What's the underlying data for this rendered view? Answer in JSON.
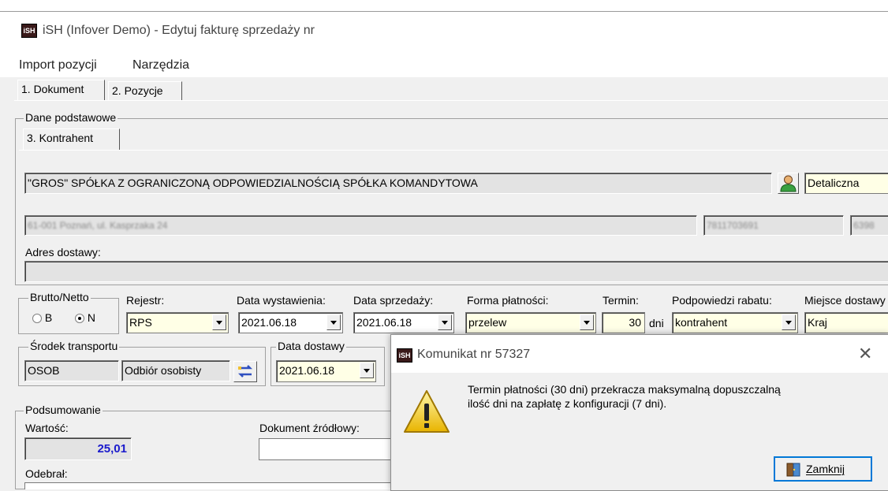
{
  "window": {
    "title": "iSH (Infover Demo) - Edytuj fakturę sprzedaży nr",
    "icon": "ish-app-icon"
  },
  "menu": [
    "Import pozycji",
    "Narzędzia"
  ],
  "tabs": [
    "1. Dokument",
    "2. Pozycje"
  ],
  "dane_podstawowe": {
    "label": "Dane podstawowe",
    "subtab": "3. Kontrahent",
    "kontrahent_name": "\"GROS\" SPÓŁKA Z OGRANICZONĄ ODPOWIEDZIALNOŚCIĄ SPÓŁKA KOMANDYTOWA",
    "kontrahent_icon": "person-icon",
    "cennik": "Detaliczna",
    "adres": "61-001 Poznań, ul. Kasprzaka 24",
    "nip": "7811703691",
    "regon": "6398",
    "adres_dostawy_label": "Adres dostawy:",
    "adres_dostawy_value": ""
  },
  "params": {
    "brutto_netto_label": "Brutto/Netto",
    "radio_b": "B",
    "radio_n": "N",
    "rejestr_label": "Rejestr:",
    "rejestr_value": "RPS",
    "data_wyst_label": "Data wystawienia:",
    "data_wyst_value": "2021.06.18",
    "data_sprz_label": "Data sprzedaży:",
    "data_sprz_value": "2021.06.18",
    "forma_label": "Forma płatności:",
    "forma_value": "przelew",
    "termin_label": "Termin:",
    "termin_value": "30",
    "dni_label": "dni",
    "rabat_label": "Podpowiedzi rabatu:",
    "rabat_value": "kontrahent",
    "miejsce_label": "Miejsce dostawy",
    "miejsce_value": "Kraj"
  },
  "transport": {
    "label": "Środek transportu",
    "code": "OSOB",
    "name": "Odbiór osobisty",
    "button_icon": "transfer-icon"
  },
  "dostawa": {
    "label": "Data dostawy",
    "value": "2021.06.18"
  },
  "podsumowanie": {
    "label": "Podsumowanie",
    "wartosc_label": "Wartość:",
    "wartosc_value": "25,01",
    "dok_zrodlowy_label": "Dokument źródłowy:",
    "odebral_label": "Odebrał:"
  },
  "dialog": {
    "title": "Komunikat nr 57327",
    "message_line1": "Termin płatności (30 dni) przekracza maksymalną dopuszczalną",
    "message_line2": "ilość dni na zapłatę z konfiguracji (7 dni).",
    "icon": "warning-icon",
    "close_button": "Zamknij",
    "close_icon": "door-exit-icon",
    "x_icon": "close-icon"
  },
  "colors": {
    "accent": "#0078d7",
    "value_blue": "#1a1acc",
    "combo_bg": "#ffffe6"
  }
}
